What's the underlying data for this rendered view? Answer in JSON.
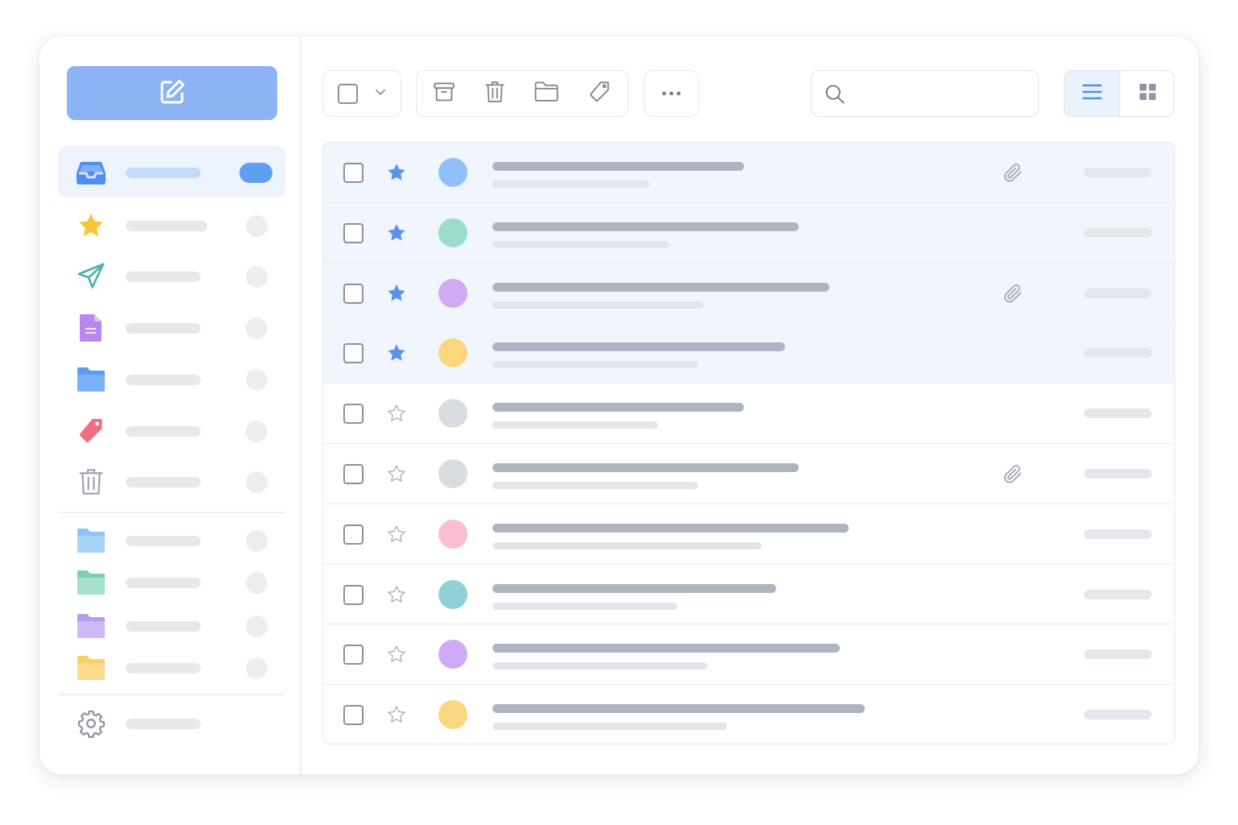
{
  "sidebar": {
    "compose": {
      "icon": "compose-icon"
    },
    "nav": [
      {
        "name": "inbox",
        "icon": "inbox-icon",
        "color": "#4f8ef0",
        "active": true
      },
      {
        "name": "starred",
        "icon": "star-icon",
        "color": "#f7c43b"
      },
      {
        "name": "sent",
        "icon": "send-icon",
        "color": "#4ab4a8"
      },
      {
        "name": "drafts",
        "icon": "draft-document-icon",
        "color": "#b888f0"
      },
      {
        "name": "folder",
        "icon": "folder-icon",
        "color": "#5b9bf0"
      },
      {
        "name": "labels",
        "icon": "tag-icon",
        "color": "#f06e80"
      },
      {
        "name": "trash",
        "icon": "trash-icon",
        "color": "#9aa1ac"
      }
    ],
    "folders": [
      {
        "name": "folder-blue",
        "icon": "folder-icon",
        "color": "#8cc4f5"
      },
      {
        "name": "folder-green",
        "icon": "folder-icon",
        "color": "#94d8c0"
      },
      {
        "name": "folder-purple",
        "icon": "folder-icon",
        "color": "#c7aef5"
      },
      {
        "name": "folder-yellow",
        "icon": "folder-icon",
        "color": "#fbd985"
      }
    ],
    "settings": {
      "icon": "gear-icon"
    }
  },
  "toolbar": {
    "select_icon": "checkbox-icon",
    "dropdown_icon": "chevron-down-icon",
    "actions": [
      "archive-icon",
      "trash-icon",
      "folder-icon",
      "tag-icon"
    ],
    "more_icon": "more-horizontal-icon",
    "search": {
      "icon": "search-icon",
      "placeholder": ""
    },
    "view": {
      "list_icon": "list-view-icon",
      "grid_icon": "grid-view-icon",
      "selected": "list"
    }
  },
  "mail_rows": [
    {
      "starred": true,
      "avatar_color": "#91bff7",
      "attachment": true
    },
    {
      "starred": true,
      "avatar_color": "#9cdccb",
      "attachment": false
    },
    {
      "starred": true,
      "avatar_color": "#cfaaf5",
      "attachment": true
    },
    {
      "starred": true,
      "avatar_color": "#fad77e",
      "attachment": false
    },
    {
      "starred": false,
      "avatar_color": "#d9dce1",
      "attachment": false
    },
    {
      "starred": false,
      "avatar_color": "#d9dce1",
      "attachment": true
    },
    {
      "starred": false,
      "avatar_color": "#fbbdd3",
      "attachment": false
    },
    {
      "starred": false,
      "avatar_color": "#8fd0d6",
      "attachment": false
    },
    {
      "starred": false,
      "avatar_color": "#cfaaf5",
      "attachment": false
    },
    {
      "starred": false,
      "avatar_color": "#fad77e",
      "attachment": false
    }
  ],
  "colors": {
    "accent": "#5f9ef0",
    "compose": "#8cb4f5",
    "starred_row": "#f1f6fe",
    "star_filled": "#5b92ec",
    "star_empty": "#a7adb8"
  }
}
